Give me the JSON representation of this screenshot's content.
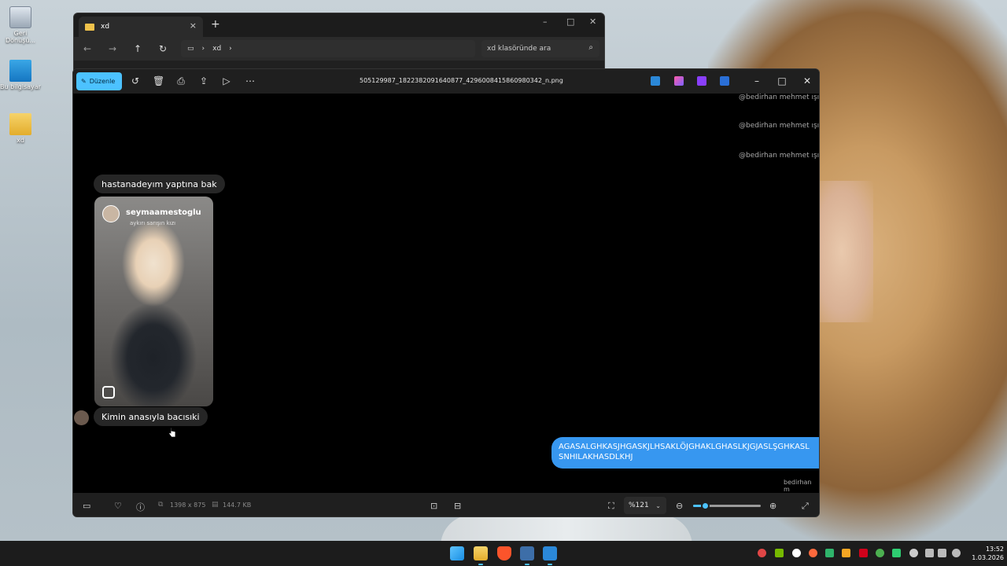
{
  "desktop": {
    "icons": [
      {
        "label": "Geri Dönüşü..."
      },
      {
        "label": "Bu bilgisayar"
      },
      {
        "label": "xd"
      }
    ]
  },
  "explorer": {
    "tab_title": "xd",
    "tab_close": "×",
    "tab_add": "+",
    "breadcrumb_folder": "xd",
    "search_placeholder": "xd klasöründe ara",
    "controls": {
      "minimize": "–",
      "maximize": "□",
      "close": "✕"
    }
  },
  "viewer": {
    "edit_label": "Düzenle",
    "file_name": "505129987_1822382091640877_4296008415860980342_n.png",
    "controls": {
      "minimize": "–",
      "maximize": "□",
      "close": "✕"
    },
    "content": {
      "mentions": [
        "@bedirhan mehmet ışık'ı",
        "@bedirhan mehmet ışık'ı",
        "@bedirhan mehmet ışık'ı"
      ],
      "message_1": "hastanadeyım yaptına bak",
      "post_username": "seymaamestoglu",
      "post_subtitle": "aykırı sarışın kızı",
      "message_2": "Kimin anasıyla bacısıki",
      "outgoing_line_1": "AGASALGHKASJHGASKJLHSAKLÖJGHAKLGHASLKJGJASLŞGHKASL",
      "outgoing_line_2": "SNHILAKHASDLKHJ",
      "sender_name": "bedirhan m"
    },
    "status": {
      "dimensions": "1398 x 875",
      "file_size": "144.7 KB",
      "zoom": "%121",
      "zoom_fraction": 0.18
    }
  },
  "taskbar": {
    "time": "13:52",
    "date": "1.03.2026"
  },
  "colors": {
    "accent": "#4cc2ff",
    "dm_blue": "#3797f0",
    "bubble_gray": "#262626"
  }
}
